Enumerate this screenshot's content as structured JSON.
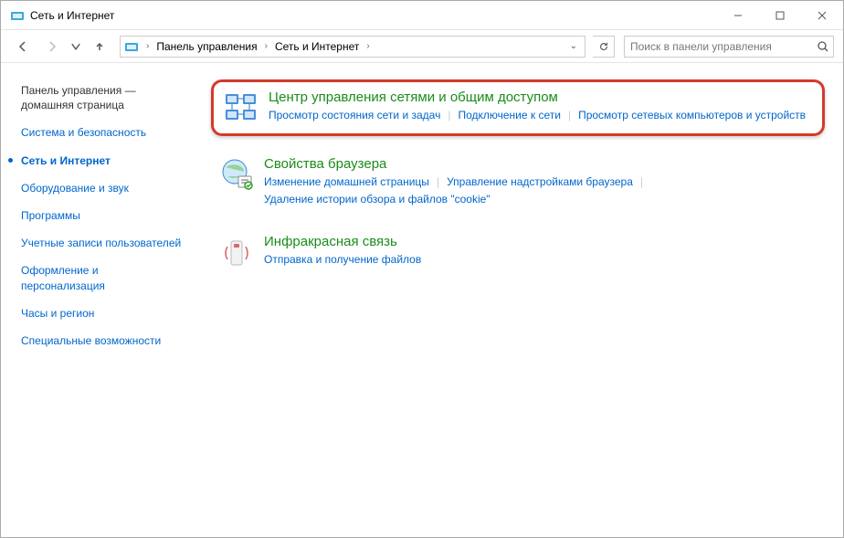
{
  "window": {
    "title": "Сеть и Интернет"
  },
  "breadcrumb": {
    "root": "Панель управления",
    "current": "Сеть и Интернет"
  },
  "search": {
    "placeholder": "Поиск в панели управления"
  },
  "sidebar": {
    "items": [
      {
        "label": "Панель управления — домашняя страница",
        "kind": "home"
      },
      {
        "label": "Система и безопасность",
        "kind": "link"
      },
      {
        "label": "Сеть и Интернет",
        "kind": "active"
      },
      {
        "label": "Оборудование и звук",
        "kind": "link"
      },
      {
        "label": "Программы",
        "kind": "link"
      },
      {
        "label": "Учетные записи пользователей",
        "kind": "link"
      },
      {
        "label": "Оформление и персонализация",
        "kind": "link"
      },
      {
        "label": "Часы и регион",
        "kind": "link"
      },
      {
        "label": "Специальные возможности",
        "kind": "link"
      }
    ]
  },
  "categories": [
    {
      "title": "Центр управления сетями и общим доступом",
      "highlighted": true,
      "links": [
        "Просмотр состояния сети и задач",
        "Подключение к сети",
        "Просмотр сетевых компьютеров и устройств"
      ]
    },
    {
      "title": "Свойства браузера",
      "highlighted": false,
      "links": [
        "Изменение домашней страницы",
        "Управление надстройками браузера",
        "Удаление истории обзора и файлов \"cookie\""
      ]
    },
    {
      "title": "Инфракрасная связь",
      "highlighted": false,
      "links": [
        "Отправка и получение файлов"
      ]
    }
  ]
}
